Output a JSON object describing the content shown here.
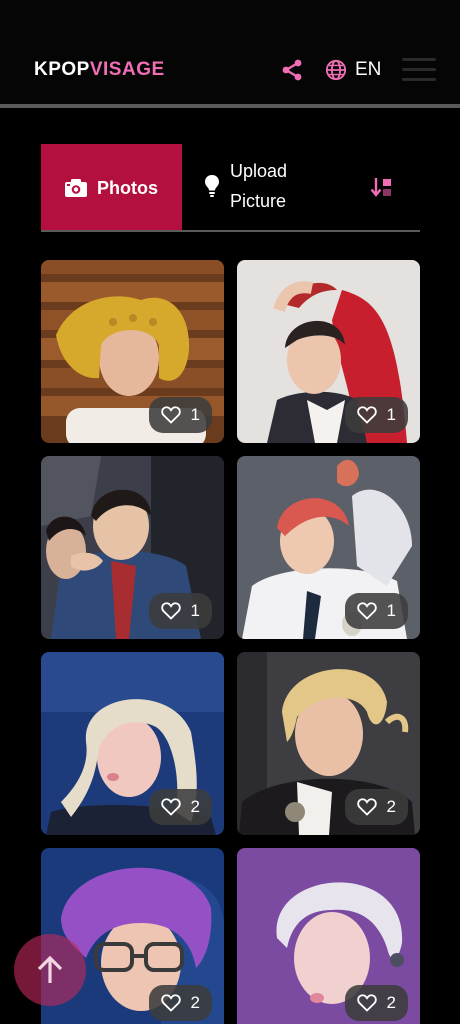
{
  "header": {
    "logo_part1": "KPOP",
    "logo_part2": "VISAGE",
    "lang_label": "EN",
    "share_icon": "share-icon",
    "globe_icon": "globe-icon",
    "menu_icon": "hamburger-menu-icon"
  },
  "tabs": {
    "photos_label": "Photos",
    "upload_label": "Upload Picture",
    "photos_icon": "camera-icon",
    "upload_icon": "lightbulb-icon",
    "sort_icon": "sort-icon"
  },
  "colors": {
    "accent_pink": "#f06eb4",
    "active_tab": "#b4103f",
    "background": "#000000"
  },
  "photos": [
    {
      "likes": "1"
    },
    {
      "likes": "1"
    },
    {
      "likes": "1"
    },
    {
      "likes": "1"
    },
    {
      "likes": "2"
    },
    {
      "likes": "2"
    },
    {
      "likes": "2"
    },
    {
      "likes": "2"
    }
  ],
  "scroll_top_icon": "arrow-up-icon"
}
